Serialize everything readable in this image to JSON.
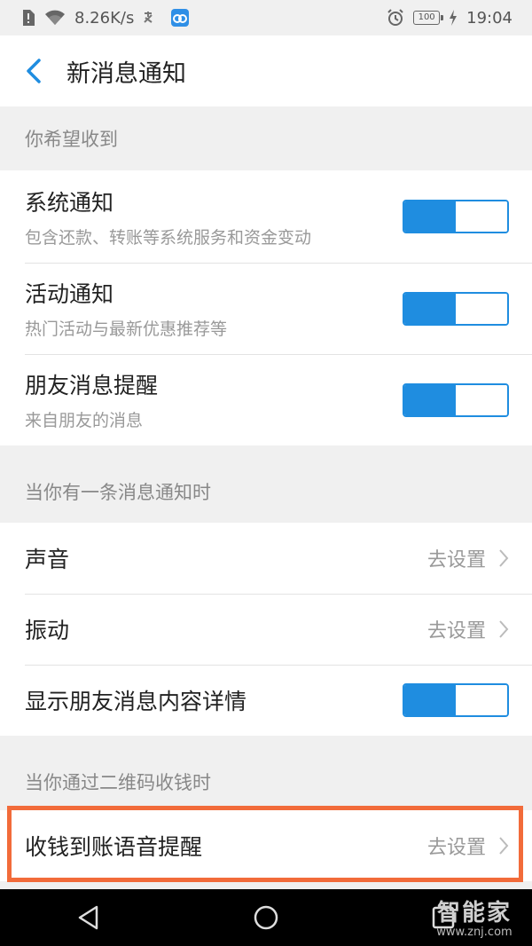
{
  "status_bar": {
    "speed": "8.26K/s",
    "battery": "100",
    "time": "19:04"
  },
  "nav": {
    "title": "新消息通知"
  },
  "sections": [
    {
      "header": "你希望收到",
      "rows": [
        {
          "title": "系统通知",
          "subtitle": "包含还款、转账等系统服务和资金变动",
          "toggle_on": true
        },
        {
          "title": "活动通知",
          "subtitle": "热门活动与最新优惠推荐等",
          "toggle_on": true
        },
        {
          "title": "朋友消息提醒",
          "subtitle": "来自朋友的消息",
          "toggle_on": true
        }
      ]
    },
    {
      "header": "当你有一条消息通知时",
      "rows": [
        {
          "title": "声音",
          "action": "去设置"
        },
        {
          "title": "振动",
          "action": "去设置"
        },
        {
          "title": "显示朋友消息内容详情",
          "toggle_on": true
        }
      ]
    },
    {
      "header": "当你通过二维码收钱时",
      "rows": [
        {
          "title": "收钱到账语音提醒",
          "action": "去设置"
        }
      ]
    }
  ],
  "watermark": {
    "main": "智能家",
    "sub": "www.znj.com"
  },
  "colors": {
    "accent": "#1f8de0",
    "highlight": "#f26b3a"
  }
}
